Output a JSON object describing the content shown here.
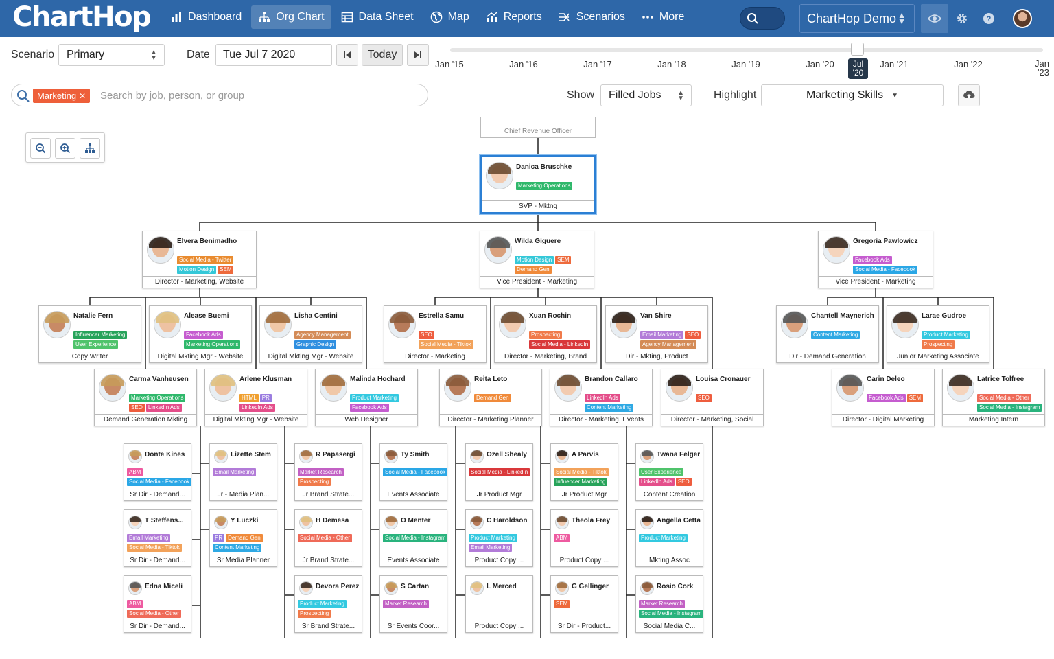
{
  "app": {
    "logo": "ChartHop"
  },
  "nav": [
    {
      "label": "Dashboard",
      "icon": "bar-chart-icon",
      "active": false
    },
    {
      "label": "Org Chart",
      "icon": "org-chart-icon",
      "active": true
    },
    {
      "label": "Data Sheet",
      "icon": "table-icon",
      "active": false
    },
    {
      "label": "Map",
      "icon": "globe-icon",
      "active": false
    },
    {
      "label": "Reports",
      "icon": "reports-icon",
      "active": false
    },
    {
      "label": "Scenarios",
      "icon": "scenarios-icon",
      "active": false
    },
    {
      "label": "More",
      "icon": "ellipsis-icon",
      "active": false
    }
  ],
  "org": {
    "name": "ChartHop Demo"
  },
  "controls": {
    "scenario_label": "Scenario",
    "scenario_value": "Primary",
    "date_label": "Date",
    "date_value": "Tue Jul 7 2020",
    "today_label": "Today",
    "show_label": "Show",
    "show_value": "Filled Jobs",
    "highlight_label": "Highlight",
    "highlight_value": "Marketing Skills",
    "search_chip": "Marketing",
    "search_placeholder": "Search by job, person, or group"
  },
  "timeline": {
    "labels": [
      "Jan '15",
      "Jan '16",
      "Jan '17",
      "Jan '18",
      "Jan '19",
      "Jan '20",
      "Jan '21",
      "Jan '22",
      "Jan '23"
    ],
    "current": "Jul '20"
  },
  "top_title": "Chief Revenue Officer",
  "tag_colors": {
    "Marketing Operations": "#2fb86b",
    "Social Media - Twitter": "#e98b2f",
    "Motion Design": "#35c8d8",
    "SEM": "#ee6a3c",
    "Demand Gen": "#f08a3a",
    "Facebook Ads": "#c55ccf",
    "Social Media - Facebook": "#2aa7e6",
    "Influencer Marketing": "#27a35a",
    "User Experience": "#4fc36b",
    "Agency Management": "#d48b56",
    "Graphic Design": "#2f8fe0",
    "SEO": "#ee5d3e",
    "Social Media - Tiktok": "#f2a25a",
    "Email Marketing": "#b27bd8",
    "Prospecting": "#f07a4a",
    "Social Media - LinkedIn": "#d9383a",
    "Content Marketing": "#2fa9e4",
    "Product Marketing": "#33c9e0",
    "LinkedIn Ads": "#e44e8a",
    "HTML": "#f0a030",
    "PR": "#9b7de0",
    "Social Media - Other": "#ef6a58",
    "Social Media - Instagram": "#29b37d",
    "ABM": "#ee5aa0",
    "Market Research": "#c260c4",
    "Content Creation": "#29a4e0"
  },
  "cards": [
    {
      "name": "Danica Bruschke",
      "title": "SVP - Mktng",
      "tags": [
        "Marketing Operations"
      ],
      "selected": true
    },
    {
      "name": "Elvera Benimadho",
      "title": "Director - Marketing, Website",
      "tags": [
        "Social Media - Twitter",
        "Motion Design",
        "SEM"
      ]
    },
    {
      "name": "Wilda Giguere",
      "title": "Vice President - Marketing",
      "tags": [
        "Motion Design",
        "SEM",
        "Demand Gen"
      ]
    },
    {
      "name": "Gregoria Pawlowicz",
      "title": "Vice President - Marketing",
      "tags": [
        "Facebook Ads",
        "Social Media - Facebook"
      ]
    },
    {
      "name": "Natalie Fern",
      "title": "Copy Writer",
      "tags": [
        "Influencer Marketing",
        "User Experience"
      ]
    },
    {
      "name": "Alease Buemi",
      "title": "Digital Mkting Mgr - Website",
      "tags": [
        "Facebook Ads",
        "Marketing Operations"
      ]
    },
    {
      "name": "Lisha Centini",
      "title": "Digital Mkting Mgr - Website",
      "tags": [
        "Agency Management",
        "Graphic Design"
      ]
    },
    {
      "name": "Estrella Samu",
      "title": "Director - Marketing",
      "tags": [
        "SEO",
        "Social Media - Tiktok"
      ]
    },
    {
      "name": "Xuan Rochin",
      "title": "Director - Marketing, Brand",
      "tags": [
        "Prospecting",
        "Social Media - LinkedIn"
      ]
    },
    {
      "name": "Van Shire",
      "title": "Dir - Mkting, Product",
      "tags": [
        "Email Marketing",
        "SEO",
        "Agency Management"
      ]
    },
    {
      "name": "Chantell Maynerich",
      "title": "Dir - Demand Generation",
      "tags": [
        "Content Marketing"
      ]
    },
    {
      "name": "Larae Gudroe",
      "title": "Junior Marketing Associate",
      "tags": [
        "Product Marketing",
        "Prospecting"
      ]
    },
    {
      "name": "Carma Vanheusen",
      "title": "Demand Generation Mkting",
      "tags": [
        "Marketing Operations",
        "SEO",
        "LinkedIn Ads"
      ]
    },
    {
      "name": "Arlene Klusman",
      "title": "Digital Mkting Mgr - Website",
      "tags": [
        "HTML",
        "PR",
        "LinkedIn Ads"
      ]
    },
    {
      "name": "Malinda Hochard",
      "title": "Web Designer",
      "tags": [
        "Product Marketing",
        "Facebook Ads"
      ]
    },
    {
      "name": "Reita Leto",
      "title": "Director - Marketing Planner",
      "tags": [
        "Demand Gen"
      ]
    },
    {
      "name": "Brandon Callaro",
      "title": "Director - Marketing, Events",
      "tags": [
        "LinkedIn Ads",
        "Content Marketing"
      ]
    },
    {
      "name": "Louisa Cronauer",
      "title": "Director - Marketing, Social",
      "tags": [
        "SEO"
      ]
    },
    {
      "name": "Carin Deleo",
      "title": "Director - Digital Marketing",
      "tags": [
        "Facebook Ads",
        "SEM"
      ]
    },
    {
      "name": "Latrice Tolfree",
      "title": "Marketing Intern",
      "tags": [
        "Social Media - Other",
        "Social Media - Instagram"
      ]
    },
    {
      "name": "Donte Kines",
      "title": "Sr Dir - Demand...",
      "tags": [
        "ABM",
        "Social Media - Facebook"
      ]
    },
    {
      "name": "Lizette Stem",
      "title": "Jr - Media Plan...",
      "tags": [
        "Email Marketing"
      ]
    },
    {
      "name": "R Papasergi",
      "title": "Jr Brand Strate...",
      "tags": [
        "Market Research",
        "Prospecting"
      ]
    },
    {
      "name": "Ty Smith",
      "title": "Events Associate",
      "tags": [
        "Social Media - Facebook"
      ]
    },
    {
      "name": "Ozell Shealy",
      "title": "Jr Product Mgr",
      "tags": [
        "Social Media - LinkedIn"
      ]
    },
    {
      "name": "A Parvis",
      "title": "Jr Product Mgr",
      "tags": [
        "Social Media - Tiktok",
        "Influencer Marketing"
      ]
    },
    {
      "name": "Twana Felger",
      "title": "Content Creation",
      "tags": [
        "User Experience",
        "LinkedIn Ads",
        "SEO"
      ]
    },
    {
      "name": "T Steffens...",
      "title": "Sr Dir - Demand...",
      "tags": [
        "Email Marketing",
        "Social Media - Tiktok"
      ]
    },
    {
      "name": "Y Luczki",
      "title": "Sr Media Planner",
      "tags": [
        "PR",
        "Demand Gen",
        "Content Marketing"
      ]
    },
    {
      "name": "H Demesa",
      "title": "Jr Brand Strate...",
      "tags": [
        "Social Media - Other"
      ]
    },
    {
      "name": "O Menter",
      "title": "Events Associate",
      "tags": [
        "Social Media - Instagram"
      ]
    },
    {
      "name": "C Haroldson",
      "title": "Product Copy ...",
      "tags": [
        "Product Marketing",
        "Email Marketing"
      ]
    },
    {
      "name": "Theola Frey",
      "title": "Product Copy ...",
      "tags": [
        "ABM"
      ]
    },
    {
      "name": "Angella Cetta",
      "title": "Mkting Assoc",
      "tags": [
        "Product Marketing"
      ]
    },
    {
      "name": "Edna Miceli",
      "title": "Sr Dir - Demand...",
      "tags": [
        "ABM",
        "Social Media - Other"
      ]
    },
    {
      "name": "Devora Perez",
      "title": "Sr Brand Strate...",
      "tags": [
        "Product Marketing",
        "Prospecting"
      ]
    },
    {
      "name": "S Cartan",
      "title": "Sr Events Coor...",
      "tags": [
        "Market Research"
      ]
    },
    {
      "name": "L Merced",
      "title": "Product Copy ...",
      "tags": []
    },
    {
      "name": "G Gellinger",
      "title": "Sr Dir - Product...",
      "tags": [
        "SEM"
      ]
    },
    {
      "name": "Rosio Cork",
      "title": "Social Media C...",
      "tags": [
        "Market Research",
        "Social Media - Instagram"
      ]
    }
  ]
}
